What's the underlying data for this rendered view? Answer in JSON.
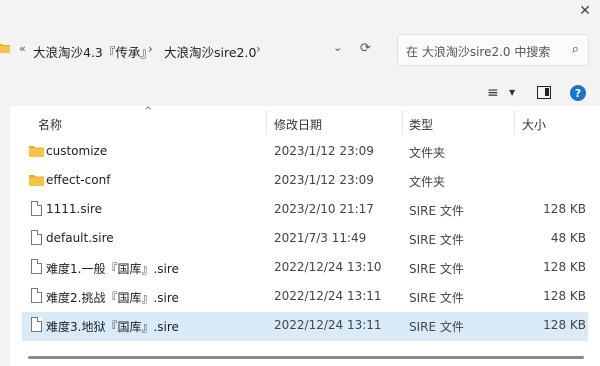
{
  "window": {
    "close_glyph": "✕"
  },
  "address_bar": {
    "back_glyph": "«",
    "crumbs": [
      "大浪淘沙4.3『传承』",
      "大浪淘沙sire2.0"
    ],
    "separator": "›",
    "dropdown_glyph": "⌄",
    "refresh_glyph": "⟳"
  },
  "search": {
    "placeholder": "在 大浪淘沙sire2.0 中搜索",
    "icon_glyph": "⌕"
  },
  "toolbar": {
    "view_glyph": "≡",
    "view_dd_glyph": "▼",
    "help_label": "?"
  },
  "columns": {
    "name": "名称",
    "date": "修改日期",
    "type": "类型",
    "size": "大小",
    "sort_glyph": "^"
  },
  "files": [
    {
      "icon": "folder-icon",
      "name": "customize",
      "date": "2023/1/12 23:09",
      "type": "文件夹",
      "size": ""
    },
    {
      "icon": "folder-icon",
      "name": "effect-conf",
      "date": "2023/1/12 23:09",
      "type": "文件夹",
      "size": ""
    },
    {
      "icon": "file-icon",
      "name": "1111.sire",
      "date": "2023/2/10 21:17",
      "type": "SIRE 文件",
      "size": "128 KB"
    },
    {
      "icon": "file-icon",
      "name": "default.sire",
      "date": "2021/7/3 11:49",
      "type": "SIRE 文件",
      "size": "48 KB"
    },
    {
      "icon": "file-icon",
      "name": "难度1.一般『国库』.sire",
      "date": "2022/12/24 13:10",
      "type": "SIRE 文件",
      "size": "128 KB"
    },
    {
      "icon": "file-icon",
      "name": "难度2.挑战『国库』.sire",
      "date": "2022/12/24 13:11",
      "type": "SIRE 文件",
      "size": "128 KB"
    },
    {
      "icon": "file-icon",
      "name": "难度3.地狱『国库』.sire",
      "date": "2022/12/24 13:11",
      "type": "SIRE 文件",
      "size": "128 KB",
      "selected": true
    }
  ],
  "colors": {
    "folder": "#f5c445",
    "folder_dark": "#e8ad22",
    "selected": "#d9ebf9",
    "help": "#1e73c8"
  }
}
